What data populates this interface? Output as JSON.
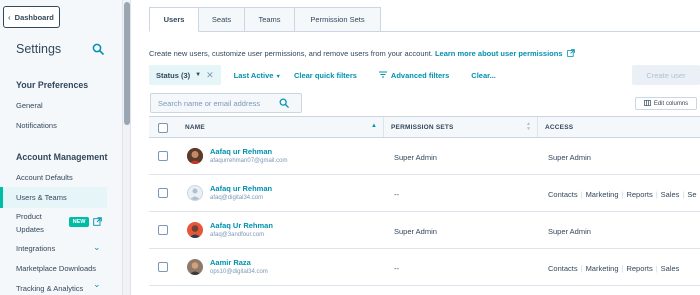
{
  "sidebar": {
    "dashboard_label": "Dashboard",
    "title": "Settings",
    "sections": [
      {
        "heading": "Your Preferences",
        "items": [
          "General",
          "Notifications"
        ]
      },
      {
        "heading": "Account Management",
        "items": [
          "Account Defaults",
          "Users & Teams",
          "Product Updates",
          "Integrations",
          "Marketplace Downloads",
          "Tracking & Analytics"
        ]
      }
    ],
    "product_updates_line1": "Product",
    "product_updates_line2": "Updates",
    "new_badge": "NEW"
  },
  "tabs": [
    "Users",
    "Seats",
    "Teams",
    "Permission Sets"
  ],
  "description": {
    "text": "Create new users, customize user permissions, and remove users from your account.",
    "link": "Learn more about user permissions"
  },
  "filters": {
    "status": "Status (3)",
    "last_active": "Last Active",
    "clear_quick": "Clear quick filters",
    "advanced": "Advanced filters",
    "clear": "Clear...",
    "create_user": "Create user"
  },
  "search": {
    "placeholder": "Search name or email address"
  },
  "edit_columns": "Edit columns",
  "table": {
    "headers": {
      "name": "NAME",
      "permission_sets": "PERMISSION SETS",
      "access": "ACCESS"
    },
    "rows": [
      {
        "name": "Aafaq ur Rehman",
        "email": "afaqurrehman07@gmail.com",
        "permission_set": "Super Admin",
        "access": "Super Admin",
        "access_list": []
      },
      {
        "name": "Aafaq ur Rehman",
        "email": "afaq@digital34.com",
        "permission_set": "--",
        "access": "",
        "access_list": [
          "Contacts",
          "Marketing",
          "Reports",
          "Sales",
          "Se"
        ]
      },
      {
        "name": "Aafaq Ur Rehman",
        "email": "afaq@3andfour.com",
        "permission_set": "Super Admin",
        "access": "Super Admin",
        "access_list": []
      },
      {
        "name": "Aamir Raza",
        "email": "ops10@digital34.com",
        "permission_set": "--",
        "access": "",
        "access_list": [
          "Contacts",
          "Marketing",
          "Reports",
          "Sales"
        ]
      }
    ]
  },
  "colors": {
    "accent": "#0091ae",
    "teal": "#00bda5",
    "text": "#33475b"
  }
}
